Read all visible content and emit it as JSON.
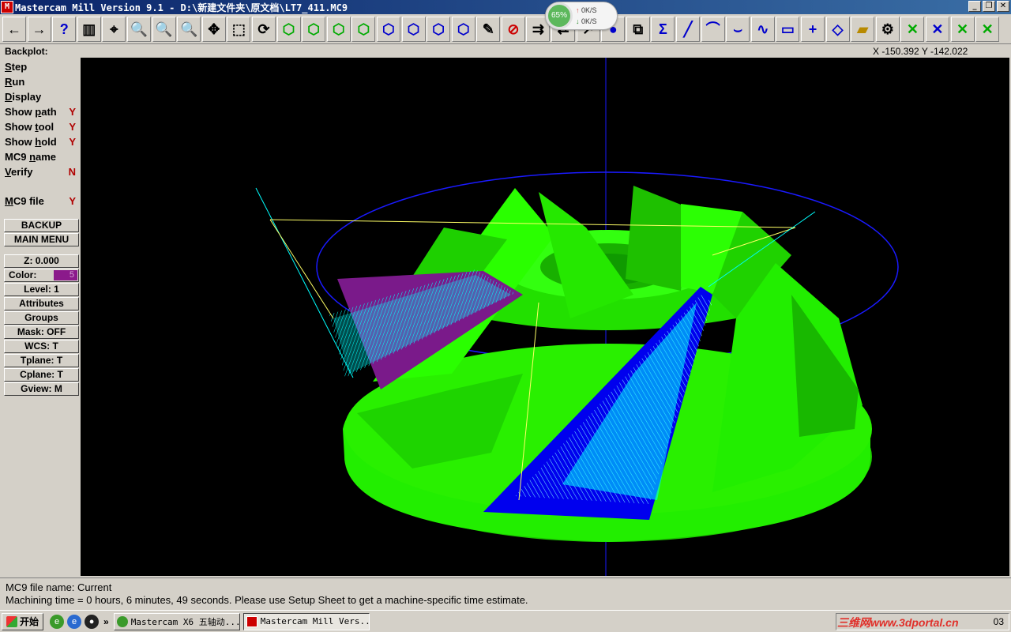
{
  "window": {
    "title": "Mastercam Mill Version 9.1 - D:\\新建文件夹\\原文档\\LT7_411.MC9",
    "app_icon_text": "M",
    "minimize": "_",
    "restore": "❐",
    "close": "✕"
  },
  "netmon": {
    "percent": "65%",
    "up": "0K/S",
    "down": "0K/S"
  },
  "toolbar": {
    "buttons": [
      {
        "name": "back",
        "glyph": "←"
      },
      {
        "name": "forward",
        "glyph": "→"
      },
      {
        "name": "help",
        "glyph": "?"
      },
      {
        "name": "tool-manager",
        "glyph": "▥"
      },
      {
        "name": "analyze",
        "glyph": "⌖"
      },
      {
        "name": "zoom-window",
        "glyph": "🔍"
      },
      {
        "name": "unzoom",
        "glyph": "🔍"
      },
      {
        "name": "zoom-auto",
        "glyph": "🔍"
      },
      {
        "name": "pan",
        "glyph": "✥"
      },
      {
        "name": "select",
        "glyph": "⬚"
      },
      {
        "name": "rotate",
        "glyph": "⟳"
      },
      {
        "name": "view-top",
        "glyph": "⬡"
      },
      {
        "name": "view-front",
        "glyph": "⬡"
      },
      {
        "name": "view-side",
        "glyph": "⬡"
      },
      {
        "name": "view-iso",
        "glyph": "⬡"
      },
      {
        "name": "cplane-top",
        "glyph": "⬡"
      },
      {
        "name": "cplane-front",
        "glyph": "⬡"
      },
      {
        "name": "cplane-side",
        "glyph": "⬡"
      },
      {
        "name": "cplane-3d",
        "glyph": "⬡"
      },
      {
        "name": "edit",
        "glyph": "✎"
      },
      {
        "name": "delete",
        "glyph": "⊘"
      },
      {
        "name": "transform",
        "glyph": "⇉"
      },
      {
        "name": "mirror",
        "glyph": "⇄"
      },
      {
        "name": "repaint",
        "glyph": "↗"
      },
      {
        "name": "shade",
        "glyph": "●"
      },
      {
        "name": "group",
        "glyph": "⧉"
      },
      {
        "name": "sum",
        "glyph": "Σ"
      },
      {
        "name": "line",
        "glyph": "╱"
      },
      {
        "name": "arc",
        "glyph": "⌒"
      },
      {
        "name": "fillet",
        "glyph": "⌣"
      },
      {
        "name": "spline",
        "glyph": "∿"
      },
      {
        "name": "rectangle",
        "glyph": "▭"
      },
      {
        "name": "point",
        "glyph": "+"
      },
      {
        "name": "surface",
        "glyph": "◇"
      },
      {
        "name": "solid",
        "glyph": "▰"
      },
      {
        "name": "toolpath",
        "glyph": "⚙"
      },
      {
        "name": "trim-1",
        "glyph": "✕"
      },
      {
        "name": "trim-2",
        "glyph": "✕"
      },
      {
        "name": "trim-3",
        "glyph": "✕"
      },
      {
        "name": "trim-4",
        "glyph": "✕"
      }
    ]
  },
  "status": {
    "label": "Backplot:",
    "coords": "X -150.392  Y -142.022"
  },
  "menu": {
    "items": [
      {
        "u": "S",
        "rest": "tep",
        "flag": ""
      },
      {
        "u": "R",
        "rest": "un",
        "flag": ""
      },
      {
        "u": "D",
        "rest": "isplay",
        "flag": ""
      },
      {
        "u": "",
        "rest": "Show ",
        "u2": "p",
        "rest2": "ath",
        "flag": "Y"
      },
      {
        "u": "",
        "rest": "Show ",
        "u2": "t",
        "rest2": "ool",
        "flag": "Y"
      },
      {
        "u": "",
        "rest": "Show ",
        "u2": "h",
        "rest2": "old",
        "flag": "Y"
      },
      {
        "u": "",
        "rest": "MC9 ",
        "u2": "n",
        "rest2": "ame",
        "flag": ""
      },
      {
        "u": "V",
        "rest": "erify",
        "flag": "N"
      },
      {
        "u": "M",
        "rest": "C9 file",
        "flag": "Y"
      }
    ],
    "backup": "BACKUP",
    "main_menu": "MAIN MENU",
    "z": "Z:   0.000",
    "color_label": "Color:",
    "color_value": "5",
    "level": "Level:  1",
    "attributes": "Attributes",
    "groups": "Groups",
    "mask": "Mask:  OFF",
    "wcs": "WCS:   T",
    "tplane": "Tplane:  T",
    "cplane": "Cplane:  T",
    "gview": "Gview:   M"
  },
  "prompt": {
    "line1": "MC9 file name: Current",
    "line2": "Machining time = 0 hours, 6 minutes, 49 seconds. Please use Setup Sheet to get a machine-specific time estimate."
  },
  "taskbar": {
    "start": "开始",
    "chevron": "»",
    "tasks": [
      {
        "label": "Mastercam X6 五轴动...",
        "active": false
      },
      {
        "label": "Mastercam Mill Vers...",
        "active": true
      }
    ],
    "tray_time": "03",
    "watermark": "三维网www.3dportal.cn"
  },
  "colors": {
    "part": "#22ee00",
    "path": "#00ffff",
    "blue_face": "#0000ee",
    "stock_circle": "#1a1aff",
    "purple": "#7a1a8a"
  }
}
